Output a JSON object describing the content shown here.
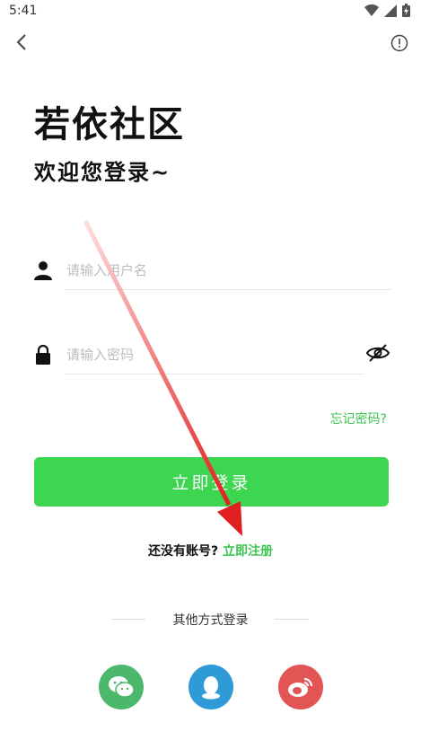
{
  "status": {
    "time": "5:41"
  },
  "header": {
    "title": "若依社区",
    "subtitle": "欢迎您登录~"
  },
  "form": {
    "username_placeholder": "请输入用户名",
    "password_placeholder": "请输入密码",
    "forgot_label": "忘记密码?",
    "login_label": "立即登录"
  },
  "register": {
    "prompt": "还没有账号?",
    "link": "立即注册"
  },
  "other": {
    "label": "其他方式登录"
  },
  "colors": {
    "accent": "#3dd650",
    "wechat": "#4cb86b",
    "qq": "#2e9bd6",
    "weibo": "#e35454",
    "annotation_arrow": "#e02020"
  },
  "icons": [
    "back-arrow-icon",
    "info-icon",
    "user-icon",
    "lock-icon",
    "eye-off-icon",
    "wechat-icon",
    "qq-icon",
    "weibo-icon"
  ]
}
